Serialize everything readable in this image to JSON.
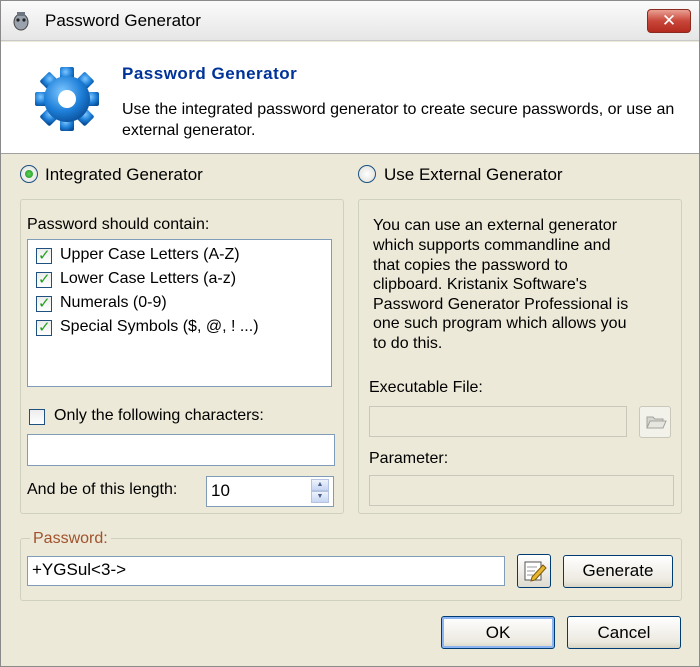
{
  "window": {
    "title": "Password Generator",
    "close_glyph": "✕"
  },
  "header": {
    "title": "Password Generator",
    "description": "Use the integrated password generator to create secure passwords, or use an external generator."
  },
  "integrated": {
    "radio_label": "Integrated Generator",
    "selected": true,
    "contain_label": "Password should contain:",
    "options": [
      {
        "label": "Upper Case Letters (A-Z)",
        "checked": true
      },
      {
        "label": "Lower Case Letters (a-z)",
        "checked": true
      },
      {
        "label": "Numerals (0-9)",
        "checked": true
      },
      {
        "label": "Special Symbols ($, @, ! ...)",
        "checked": true
      }
    ],
    "only_chars_label": "Only the following characters:",
    "only_chars_checked": false,
    "only_chars_value": "",
    "length_label": "And be of this length:",
    "length_value": "10"
  },
  "external": {
    "radio_label": "Use External Generator",
    "selected": false,
    "info_lines": [
      "You can use an external generator",
      "which supports commandline and",
      "that copies the password to",
      "clipboard. Kristanix Software's",
      "Password Generator Professional  is",
      "one such program which allows you",
      "to do this."
    ],
    "executable_label": "Executable File:",
    "executable_value": "",
    "parameter_label": "Parameter:",
    "parameter_value": ""
  },
  "password": {
    "label": "Password:",
    "value": "+YGSul<3->",
    "generate_label": "Generate"
  },
  "footer": {
    "ok_label": "OK",
    "cancel_label": "Cancel"
  },
  "colors": {
    "header_title": "#003399",
    "password_label": "#a0522d",
    "window_bg": "#ece9d8"
  },
  "icons": [
    "app-icon",
    "close-icon",
    "gear-icon",
    "folder-icon",
    "edit-icon",
    "spin-up-icon",
    "spin-down-icon"
  ]
}
